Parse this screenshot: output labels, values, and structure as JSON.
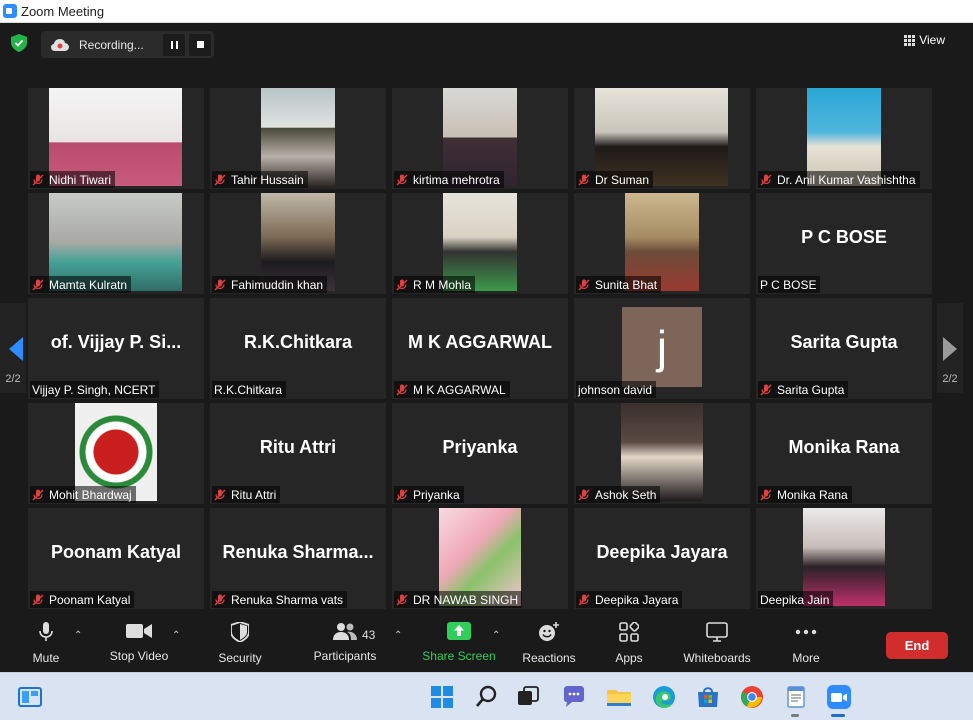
{
  "window": {
    "title": "Zoom Meeting"
  },
  "recording": {
    "status": "Recording..."
  },
  "view": {
    "label": "View"
  },
  "pagination": {
    "left_page": "2/2",
    "right_page": "2/2"
  },
  "participants": [
    {
      "label": "Nidhi Tiwari",
      "display_name": "",
      "muted": true,
      "video": true
    },
    {
      "label": "Tahir Hussain",
      "display_name": "",
      "muted": true,
      "video": true
    },
    {
      "label": "kirtima mehrotra",
      "display_name": "",
      "muted": true,
      "video": true
    },
    {
      "label": "Dr Suman",
      "display_name": "",
      "muted": true,
      "video": true
    },
    {
      "label": "Dr. Anil Kumar Vashishtha",
      "display_name": "",
      "muted": true,
      "video": true
    },
    {
      "label": "Mamta Kulratn",
      "display_name": "",
      "muted": true,
      "video": true
    },
    {
      "label": "Fahimuddin khan",
      "display_name": "",
      "muted": true,
      "video": true
    },
    {
      "label": "R M Mohla",
      "display_name": "",
      "muted": true,
      "video": true
    },
    {
      "label": "Sunita Bhat",
      "display_name": "",
      "muted": true,
      "video": true
    },
    {
      "label": "P C BOSE",
      "display_name": "P C BOSE",
      "muted": false,
      "video": false
    },
    {
      "label": "Vijjay P. Singh,  NCERT",
      "display_name": "of. Vijjay P. Si...",
      "muted": false,
      "video": false
    },
    {
      "label": "R.K.Chitkara",
      "display_name": "R.K.Chitkara",
      "muted": false,
      "video": false
    },
    {
      "label": "M K AGGARWAL",
      "display_name": "M K AGGARWAL",
      "muted": true,
      "video": false
    },
    {
      "label": "johnson david",
      "display_name": "",
      "muted": false,
      "video": false,
      "avatar_letter": "j"
    },
    {
      "label": "Sarita Gupta",
      "display_name": "Sarita Gupta",
      "muted": true,
      "video": false
    },
    {
      "label": "Mohit Bhardwaj",
      "display_name": "",
      "muted": true,
      "video": true
    },
    {
      "label": "Ritu Attri",
      "display_name": "Ritu Attri",
      "muted": true,
      "video": false
    },
    {
      "label": "Priyanka",
      "display_name": "Priyanka",
      "muted": true,
      "video": false
    },
    {
      "label": "Ashok Seth",
      "display_name": "",
      "muted": true,
      "video": true
    },
    {
      "label": "Monika Rana",
      "display_name": "Monika Rana",
      "muted": true,
      "video": false
    },
    {
      "label": "Poonam Katyal",
      "display_name": "Poonam Katyal",
      "muted": true,
      "video": false
    },
    {
      "label": "Renuka Sharma vats",
      "display_name": "Renuka  Sharma...",
      "muted": true,
      "video": false
    },
    {
      "label": "DR NAWAB SINGH",
      "display_name": "",
      "muted": true,
      "video": true
    },
    {
      "label": "Deepika Jayara",
      "display_name": "Deepika Jayara",
      "muted": true,
      "video": false
    },
    {
      "label": "Deepika Jain",
      "display_name": "",
      "muted": false,
      "video": true
    }
  ],
  "toolbar": {
    "mute": "Mute",
    "stop_video": "Stop Video",
    "security": "Security",
    "participants": "Participants",
    "participants_count": "43",
    "share_screen": "Share Screen",
    "reactions": "Reactions",
    "apps": "Apps",
    "whiteboards": "Whiteboards",
    "more": "More",
    "end": "End"
  },
  "colors": {
    "share_green": "#2fcf5a",
    "end_red": "#d12d2d",
    "arrow_blue": "#2d8cff",
    "mute_red": "#e04040"
  }
}
